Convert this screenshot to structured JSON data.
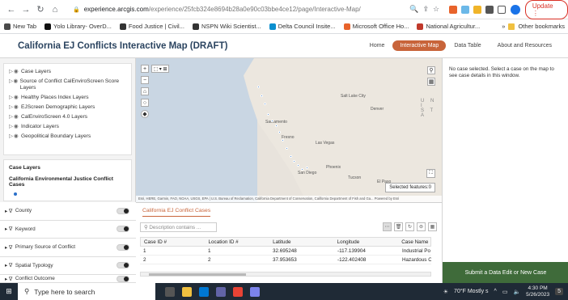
{
  "browser": {
    "url_domain": "experience.arcgis.com",
    "url_path": "/experience/25fcb324e8694b28a0e90c03bbe4ce12/page/Interactive-Map/",
    "update_label": "Update",
    "profile_initial": "J",
    "bookmarks": [
      {
        "label": "New Tab",
        "color": "#4a4a4a"
      },
      {
        "label": "Yolo Library- OverD...",
        "color": "#111111"
      },
      {
        "label": "Food Justice | Civil...",
        "color": "#333333"
      },
      {
        "label": "NSPN Wiki Scientist...",
        "color": "#333333"
      },
      {
        "label": "Delta Council Insite...",
        "color": "#0b8fcf"
      },
      {
        "label": "Microsoft Office Ho...",
        "color": "#e8632b"
      },
      {
        "label": "National Agricultur...",
        "color": "#c0392b"
      }
    ],
    "more_label": "»",
    "other_bookmarks": "Other bookmarks"
  },
  "app": {
    "title": "California EJ Conflicts Interactive Map (DRAFT)",
    "nav": {
      "home": "Home",
      "interactive_map": "Interactive Map",
      "data_table": "Data Table",
      "about": "About and Resources"
    },
    "accent": "#c8643a"
  },
  "layers": [
    "Case Layers",
    "Source of Conflict CalEnviroScreen Score Layers",
    "Healthy Places Index Layers",
    "EJScreen Demographic Layers",
    "CalEnviroScreen 4.0 Layers",
    "Indicator Layers",
    "Geopolitical Boundary Layers"
  ],
  "legend": {
    "heading": "Case Layers",
    "sub": "California Environmental Justice Conflict Cases"
  },
  "filters": [
    "County",
    "Keyword",
    "Primary Source of Conflict",
    "Spatial Typology",
    "Conflict Outcome"
  ],
  "map": {
    "labels": {
      "sacramento": "Sacramento",
      "fresno": "Fresno",
      "las_vegas": "Las Vegas",
      "phoenix": "Phoenix",
      "tucson": "Tucson",
      "salt_lake": "Salt Lake City",
      "denver": "Denver",
      "san_diego": "San Diego",
      "el_paso": "El Paso",
      "uni": "U N I",
      "sta": "S T A"
    },
    "selected_features": "Selected features:0",
    "attribution": "Esri, HERE, Garmin, FAO, NOAA, USGS, EPA | U.S. Bureau of Reclamation, California Department of Conservation, California Department of Fish and Ga...    Powered by Esri"
  },
  "table": {
    "tab": "California EJ Conflict Cases",
    "search_placeholder": "Description contains ...",
    "headers": [
      "Case ID #",
      "Location ID #",
      "Latitude",
      "Longitude",
      "Case Name"
    ],
    "rows": [
      [
        "1",
        "1",
        "32.695248",
        "-117.139904",
        "Industrial Po"
      ],
      [
        "2",
        "2",
        "37.953653",
        "-122.402408",
        "Hazardous C"
      ]
    ]
  },
  "right_panel": {
    "message": "No case selected. Select a case on the map to see case details in this window.",
    "submit": "Submit a Data Edit or New Case",
    "submit_color": "#3f6b3a"
  },
  "taskbar": {
    "search": "Type here to search",
    "weather": "70°F  Mostly s",
    "time": "4:30 PM",
    "date": "5/26/2023",
    "notification_count": "5"
  }
}
